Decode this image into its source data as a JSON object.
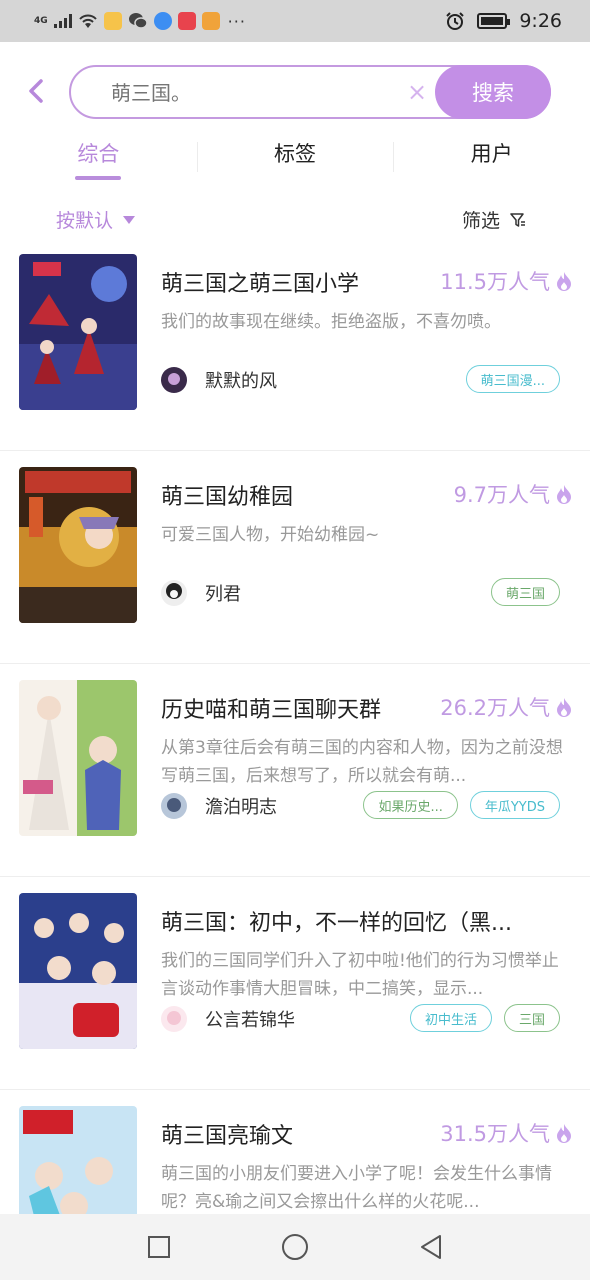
{
  "status_bar": {
    "network": "4G",
    "time": "9:26",
    "more": "···"
  },
  "search": {
    "placeholder": "萌三国。",
    "clear_label": "×",
    "button_label": "搜索"
  },
  "tabs": [
    {
      "label": "综合",
      "active": true
    },
    {
      "label": "标签",
      "active": false
    },
    {
      "label": "用户",
      "active": false
    }
  ],
  "sort": {
    "label": "按默认"
  },
  "filter": {
    "label": "筛选"
  },
  "results": [
    {
      "title": "萌三国之萌三国小学",
      "popularity": "11.5万人气",
      "description": "我们的故事现在继续。拒绝盗版，不喜勿喷。",
      "author": "默默的风",
      "tags": [
        {
          "label": "萌三国漫...",
          "color": "cyan"
        }
      ]
    },
    {
      "title": "萌三国幼稚园",
      "popularity": "9.7万人气",
      "description": "可爱三国人物，开始幼稚园~",
      "author": "列君",
      "tags": [
        {
          "label": "萌三国",
          "color": "green"
        }
      ]
    },
    {
      "title": "历史喵和萌三国聊天群",
      "popularity": "26.2万人气",
      "description": "从第3章往后会有萌三国的内容和人物，因为之前没想写萌三国，后来想写了，所以就会有萌...",
      "author": "澹泊明志",
      "tags": [
        {
          "label": "如果历史...",
          "color": "green"
        },
        {
          "label": "年瓜YYDS",
          "color": "cyan"
        }
      ]
    },
    {
      "title": "萌三国：初中，不一样的回忆（黑...",
      "popularity": "",
      "description": "我们的三国同学们升入了初中啦!他们的行为习惯举止言谈动作事情大胆冒昧，中二搞笑，显示...",
      "author": "公言若锦华",
      "tags": [
        {
          "label": "初中生活",
          "color": "cyan"
        },
        {
          "label": "三国",
          "color": "green"
        }
      ]
    },
    {
      "title": "萌三国亮瑜文",
      "popularity": "31.5万人气",
      "description": "萌三国的小朋友们要进入小学了呢！会发生什么事情呢？亮&瑜之间又会擦出什么样的火花呢...",
      "author": "",
      "tags": []
    }
  ],
  "colors": {
    "accent": "#c38fe6",
    "accent_text": "#b788db",
    "tag_cyan": "#48bccd",
    "tag_green": "#6aa86a"
  }
}
